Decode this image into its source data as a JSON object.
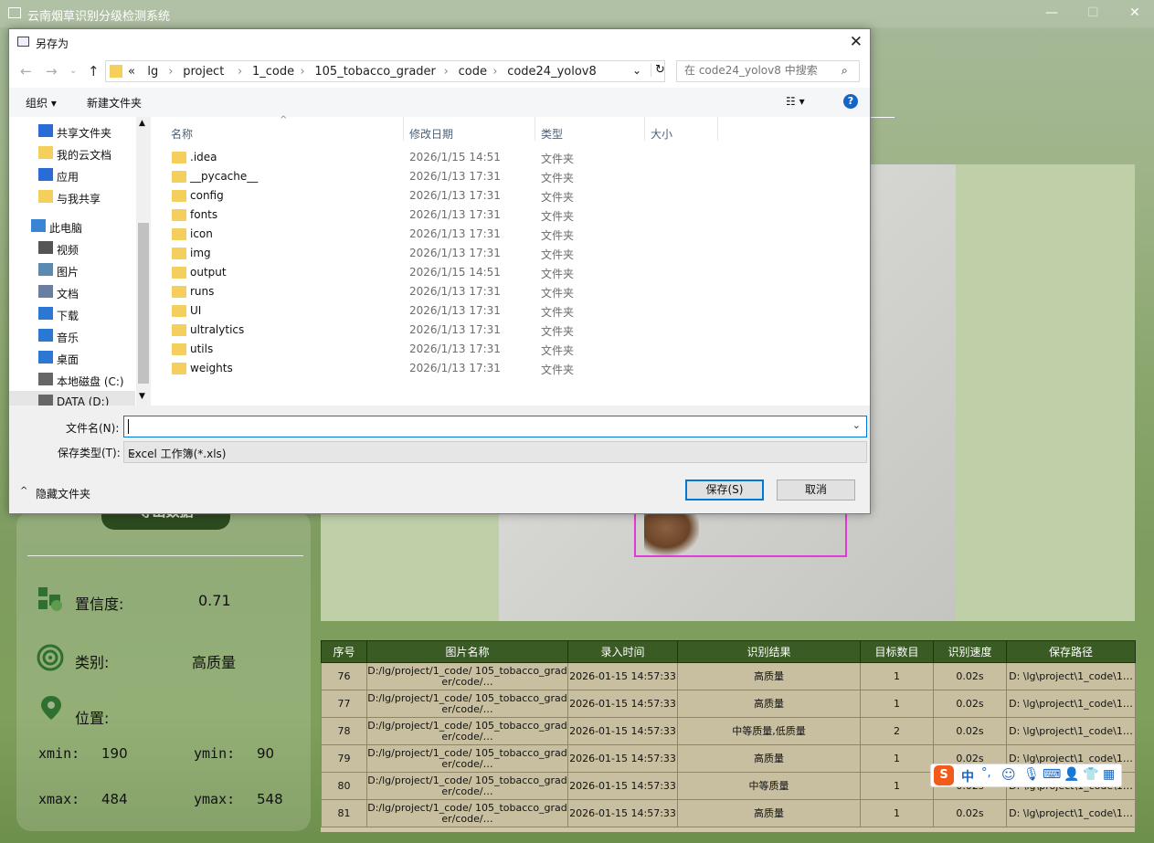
{
  "app": {
    "title": "云南烟草识别分级检测系统"
  },
  "left": {
    "export_label": "导出数据",
    "confidence_label": "置信度:",
    "confidence": "0.71",
    "class_label": "类别:",
    "class_value": "高质量",
    "pos_label": "位置:",
    "xmin_label": "xmin:",
    "xmin": "190",
    "ymin_label": "ymin:",
    "ymin": "90",
    "xmax_label": "xmax:",
    "xmax": "484",
    "ymax_label": "ymax:",
    "ymax": "548"
  },
  "table": {
    "headers": [
      "序号",
      "图片名称",
      "录入时间",
      "识别结果",
      "目标数目",
      "识别速度",
      "保存路径"
    ],
    "rows": [
      {
        "id": "76",
        "name": "D:/lg/project/1_code/ 105_tobacco_grader/code/…",
        "time": "2026-01-15 14:57:33",
        "result": "高质量",
        "count": "1",
        "speed": "0.02s",
        "path": "D: \\lg\\project\\1_code\\1…"
      },
      {
        "id": "77",
        "name": "D:/lg/project/1_code/ 105_tobacco_grader/code/…",
        "time": "2026-01-15 14:57:33",
        "result": "高质量",
        "count": "1",
        "speed": "0.02s",
        "path": "D: \\lg\\project\\1_code\\1…"
      },
      {
        "id": "78",
        "name": "D:/lg/project/1_code/ 105_tobacco_grader/code/…",
        "time": "2026-01-15 14:57:33",
        "result": "中等质量,低质量",
        "count": "2",
        "speed": "0.02s",
        "path": "D: \\lg\\project\\1_code\\1…"
      },
      {
        "id": "79",
        "name": "D:/lg/project/1_code/ 105_tobacco_grader/code/…",
        "time": "2026-01-15 14:57:33",
        "result": "高质量",
        "count": "1",
        "speed": "0.02s",
        "path": "D: \\lg\\project\\1_code\\1…"
      },
      {
        "id": "80",
        "name": "D:/lg/project/1_code/ 105_tobacco_grader/code/…",
        "time": "2026-01-15 14:57:33",
        "result": "中等质量",
        "count": "1",
        "speed": "0.02s",
        "path": "D: \\lg\\project\\1_code\\1…"
      },
      {
        "id": "81",
        "name": "D:/lg/project/1_code/ 105_tobacco_grader/code/…",
        "time": "2026-01-15 14:57:33",
        "result": "高质量",
        "count": "1",
        "speed": "0.02s",
        "path": "D: \\lg\\project\\1_code\\1…"
      }
    ]
  },
  "dialog": {
    "title": "另存为",
    "path": [
      "«",
      "lg",
      "project",
      "1_code",
      "105_tobacco_grader",
      "code",
      "code24_yolov8"
    ],
    "search_placeholder": "在 code24_yolov8 中搜索",
    "organize": "组织 ▾",
    "new_folder": "新建文件夹",
    "nav": [
      {
        "label": "共享文件夹",
        "icon": "shared-folder-icon"
      },
      {
        "label": "我的云文档",
        "icon": "cloud-doc-icon"
      },
      {
        "label": "应用",
        "icon": "apps-icon"
      },
      {
        "label": "与我共享",
        "icon": "folder-icon"
      },
      {
        "label": "此电脑",
        "icon": "computer-icon"
      },
      {
        "label": "视频",
        "icon": "video-icon"
      },
      {
        "label": "图片",
        "icon": "picture-icon"
      },
      {
        "label": "文档",
        "icon": "document-icon"
      },
      {
        "label": "下载",
        "icon": "download-icon"
      },
      {
        "label": "音乐",
        "icon": "music-icon"
      },
      {
        "label": "桌面",
        "icon": "desktop-icon"
      },
      {
        "label": "本地磁盘 (C:)",
        "icon": "disk-icon"
      },
      {
        "label": "DATA (D:)",
        "icon": "disk-icon"
      }
    ],
    "columns": {
      "name": "名称",
      "date": "修改日期",
      "type": "类型",
      "size": "大小"
    },
    "files": [
      {
        "name": ".idea",
        "date": "2026/1/15 14:51",
        "type": "文件夹"
      },
      {
        "name": "__pycache__",
        "date": "2026/1/13 17:31",
        "type": "文件夹"
      },
      {
        "name": "config",
        "date": "2026/1/13 17:31",
        "type": "文件夹"
      },
      {
        "name": "fonts",
        "date": "2026/1/13 17:31",
        "type": "文件夹"
      },
      {
        "name": "icon",
        "date": "2026/1/13 17:31",
        "type": "文件夹"
      },
      {
        "name": "img",
        "date": "2026/1/13 17:31",
        "type": "文件夹"
      },
      {
        "name": "output",
        "date": "2026/1/15 14:51",
        "type": "文件夹"
      },
      {
        "name": "runs",
        "date": "2026/1/13 17:31",
        "type": "文件夹"
      },
      {
        "name": "UI",
        "date": "2026/1/13 17:31",
        "type": "文件夹"
      },
      {
        "name": "ultralytics",
        "date": "2026/1/13 17:31",
        "type": "文件夹"
      },
      {
        "name": "utils",
        "date": "2026/1/13 17:31",
        "type": "文件夹"
      },
      {
        "name": "weights",
        "date": "2026/1/13 17:31",
        "type": "文件夹"
      }
    ],
    "filename_label": "文件名(N):",
    "filename": "",
    "filetype_label": "保存类型(T):",
    "filetype": "Excel 工作簿(*.xls)",
    "hide_folders": "隐藏文件夹",
    "save": "保存(S)",
    "cancel": "取消"
  },
  "ime": {
    "lang": "中",
    "punct": "°,"
  }
}
